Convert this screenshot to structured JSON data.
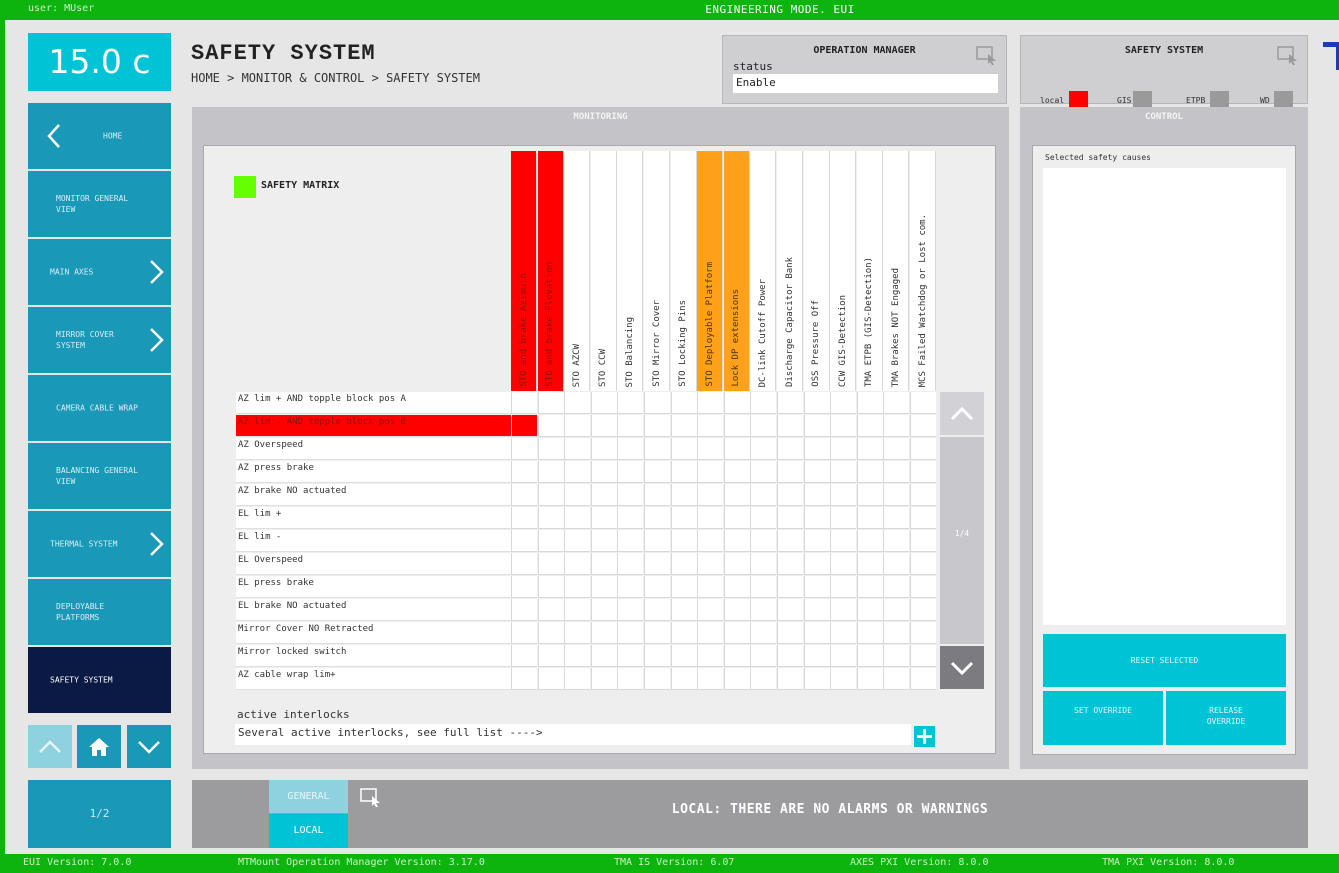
{
  "topbar": {
    "user": "user: MUser",
    "mode": "ENGINEERING MODE. EUI"
  },
  "temperature": "15.0 c",
  "sidebar": {
    "items": [
      {
        "label": "HOME"
      },
      {
        "label": "MONITOR GENERAL VIEW"
      },
      {
        "label": "MAIN AXES"
      },
      {
        "label": "MIRROR COVER SYSTEM"
      },
      {
        "label": "CAMERA CABLE WRAP"
      },
      {
        "label": "BALANCING GENERAL VIEW"
      },
      {
        "label": "THERMAL SYSTEM"
      },
      {
        "label": "DEPLOYABLE PLATFORMS"
      },
      {
        "label": "SAFETY SYSTEM"
      }
    ],
    "page": "1/2"
  },
  "header": {
    "title": "SAFETY SYSTEM",
    "breadcrumb": "HOME > MONITOR & CONTROL > SAFETY SYSTEM"
  },
  "operation_manager": {
    "title": "OPERATION MANAGER",
    "status_label": "status",
    "status_value": "Enable"
  },
  "safety_system": {
    "title": "SAFETY SYSTEM",
    "indicators": [
      {
        "label": "local",
        "color": "#ff0000"
      },
      {
        "label": "GIS",
        "color": "#9a9a9a"
      },
      {
        "label": "ETPB",
        "color": "#9a9a9a"
      },
      {
        "label": "WD",
        "color": "#9a9a9a"
      }
    ]
  },
  "monitoring": {
    "title": "MONITORING",
    "matrix_title": "SAFETY MATRIX",
    "columns": [
      {
        "label": "STO and brake Azimuth",
        "state": "red"
      },
      {
        "label": "STO and brake Elevation",
        "state": "red"
      },
      {
        "label": "STO AZCW",
        "state": "normal"
      },
      {
        "label": "STO CCW",
        "state": "normal"
      },
      {
        "label": "STO Balancing",
        "state": "normal"
      },
      {
        "label": "STO Mirror Cover",
        "state": "normal"
      },
      {
        "label": "STO Locking Pins",
        "state": "normal"
      },
      {
        "label": "STO Deployable Platform",
        "state": "orange"
      },
      {
        "label": "Lock DP extensions",
        "state": "orange"
      },
      {
        "label": "DC-link Cutoff Power",
        "state": "normal"
      },
      {
        "label": "Discharge Capacitor Bank",
        "state": "normal"
      },
      {
        "label": "OSS Pressure Off",
        "state": "normal"
      },
      {
        "label": "CCW GIS-Detection",
        "state": "normal"
      },
      {
        "label": "TMA ETPB (GIS-Detection)",
        "state": "normal"
      },
      {
        "label": "TMA Brakes NOT Engaged",
        "state": "normal"
      },
      {
        "label": "MCS Failed Watchdog or Lost com.",
        "state": "normal"
      }
    ],
    "rows": [
      {
        "label": "AZ lim + AND topple block pos A",
        "active": false,
        "cells": []
      },
      {
        "label": "AZ lim - AND topple block pos B",
        "active": true,
        "cells": [
          0
        ]
      },
      {
        "label": "AZ Overspeed",
        "active": false,
        "cells": []
      },
      {
        "label": "AZ press brake",
        "active": false,
        "cells": []
      },
      {
        "label": "AZ brake NO actuated",
        "active": false,
        "cells": []
      },
      {
        "label": "EL lim +",
        "active": false,
        "cells": []
      },
      {
        "label": "EL lim -",
        "active": false,
        "cells": []
      },
      {
        "label": "EL Overspeed",
        "active": false,
        "cells": []
      },
      {
        "label": "EL press brake",
        "active": false,
        "cells": []
      },
      {
        "label": "EL brake NO actuated",
        "active": false,
        "cells": []
      },
      {
        "label": "Mirror Cover NO Retracted",
        "active": false,
        "cells": []
      },
      {
        "label": "Mirror locked switch",
        "active": false,
        "cells": []
      },
      {
        "label": "AZ cable wrap lim+",
        "active": false,
        "cells": []
      }
    ],
    "scroll_page": "1/4",
    "interlocks_label": "active interlocks",
    "interlocks_value": "Several active interlocks, see full list ---->"
  },
  "control": {
    "title": "CONTROL",
    "causes_label": "Selected safety causes",
    "reset_label": "RESET SELECTED",
    "set_override_label": "SET OVERRIDE",
    "release_override_label": "RELEASE OVERRIDE"
  },
  "alarms": {
    "tab_general": "GENERAL",
    "tab_local": "LOCAL",
    "message": "LOCAL: THERE ARE NO ALARMS OR WARNINGS"
  },
  "footer": {
    "eui": "EUI Version: 7.0.0",
    "mtmount": "MTMount Operation Manager Version: 3.17.0",
    "tma_is": "TMA IS Version: 6.07",
    "axes_pxi": "AXES PXI Version: 8.0.0",
    "tma_pxi": "TMA PXI Version: 8.0.0"
  },
  "colors": {
    "accent": "#00c4d6",
    "sidebar": "#1998b8",
    "active": "#0b1a44",
    "alarm": "#ff0000",
    "warning": "#ffa11a",
    "ok": "#66ff00",
    "frame": "#0db40d"
  }
}
